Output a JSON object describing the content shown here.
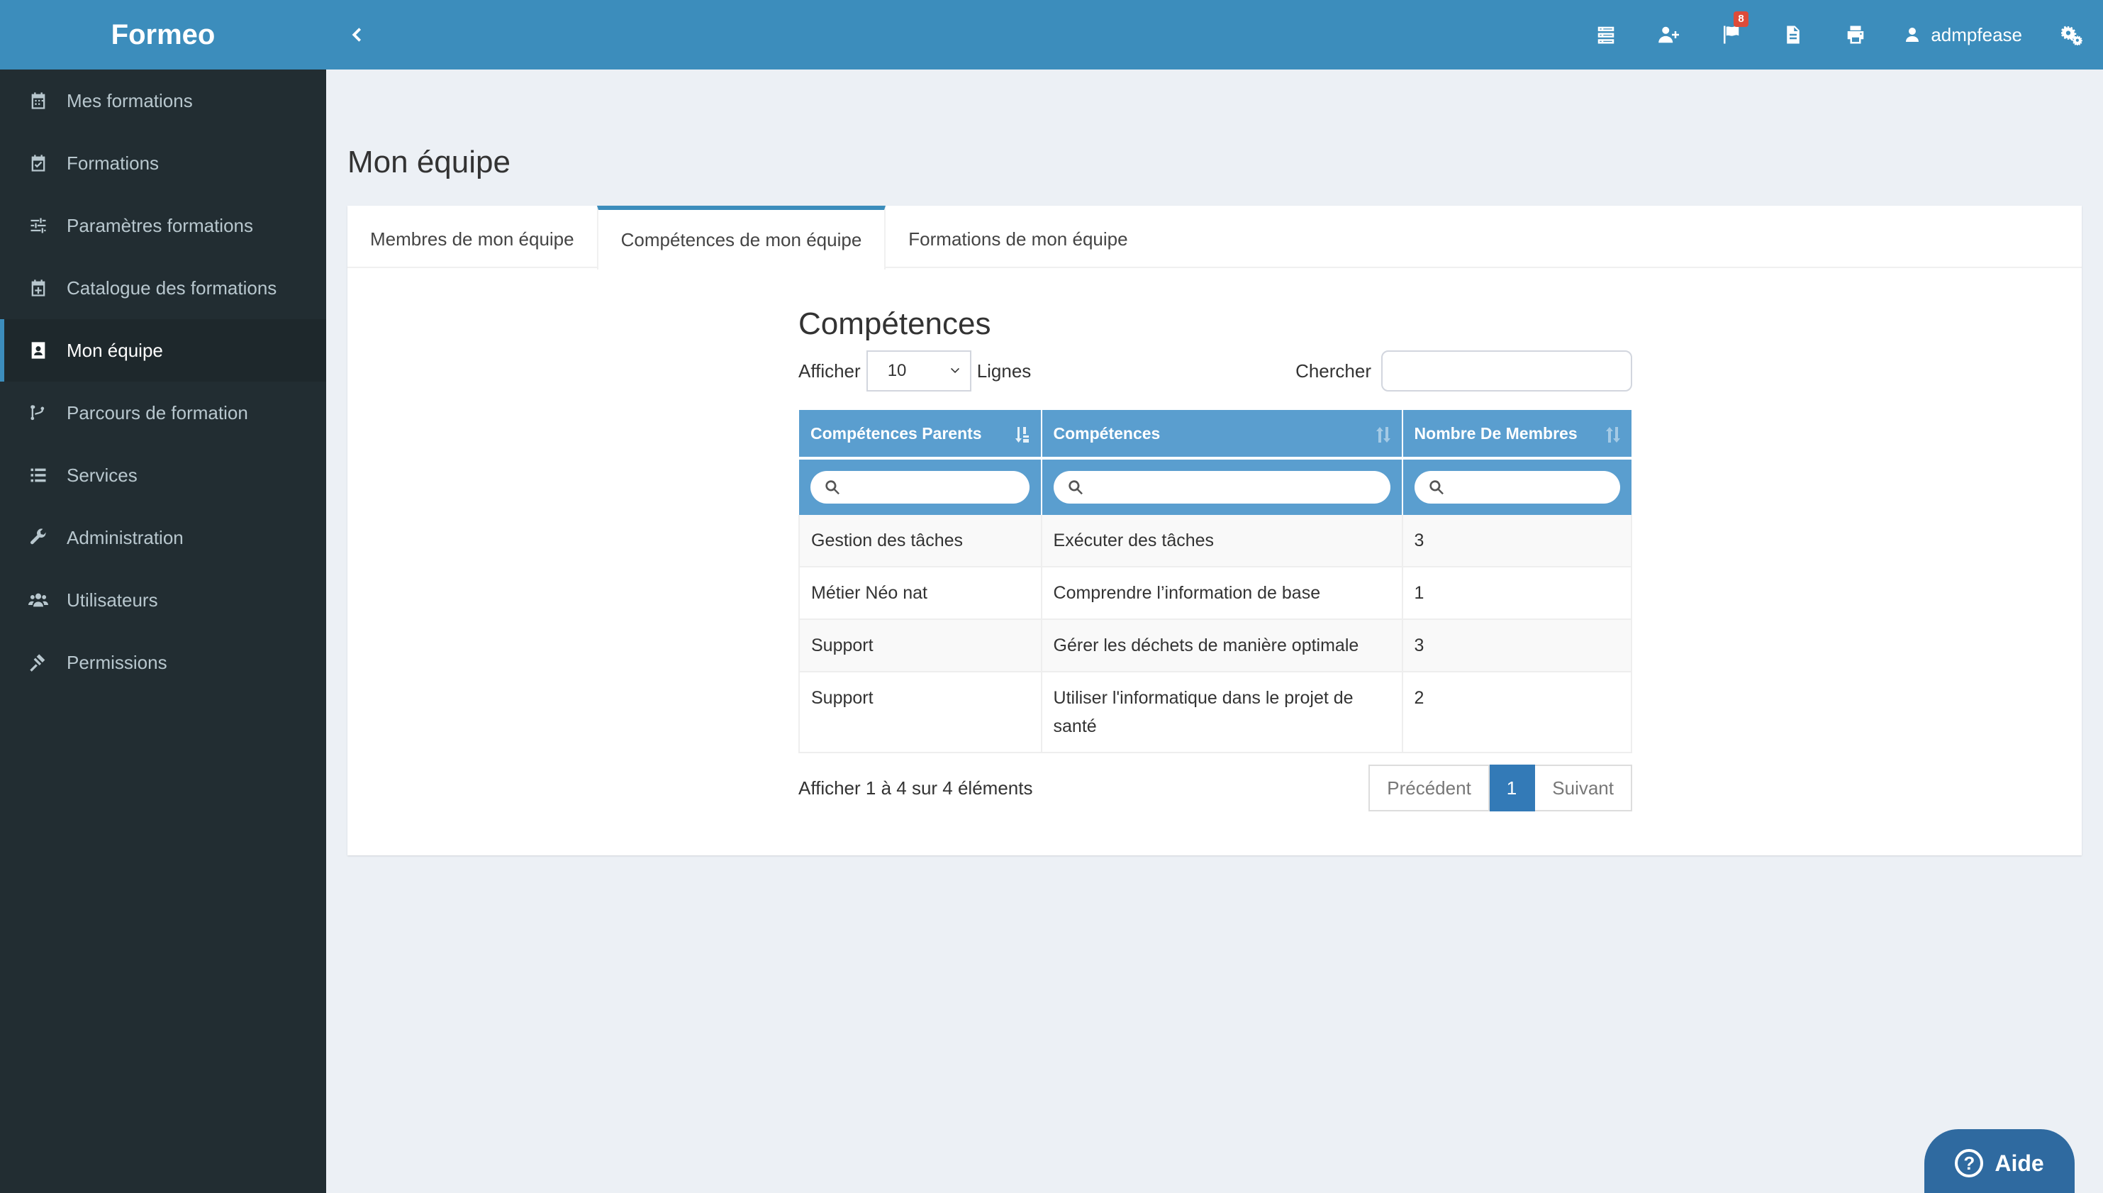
{
  "app": {
    "brand": "Formeo"
  },
  "sidebar": {
    "items": [
      {
        "label": "Mes formations",
        "icon": "calendar-icon"
      },
      {
        "label": "Formations",
        "icon": "calendar-check-icon"
      },
      {
        "label": "Paramètres formations",
        "icon": "sliders-icon"
      },
      {
        "label": "Catalogue des formations",
        "icon": "calendar-plus-icon"
      },
      {
        "label": "Mon équipe",
        "icon": "contact-card-icon",
        "active": true
      },
      {
        "label": "Parcours de formation",
        "icon": "branch-icon"
      },
      {
        "label": "Services",
        "icon": "list-icon"
      },
      {
        "label": "Administration",
        "icon": "wrench-icon"
      },
      {
        "label": "Utilisateurs",
        "icon": "users-icon"
      },
      {
        "label": "Permissions",
        "icon": "gavel-icon"
      }
    ]
  },
  "topbar": {
    "notification_count": "8",
    "username": "admpfease"
  },
  "page": {
    "title": "Mon équipe"
  },
  "tabs": [
    {
      "label": "Membres de mon équipe"
    },
    {
      "label": "Compétences de mon équipe",
      "active": true
    },
    {
      "label": "Formations de mon équipe"
    }
  ],
  "competences": {
    "title": "Compétences",
    "show_label": "Afficher",
    "page_size": "10",
    "rows_label": "Lignes",
    "search_label": "Chercher",
    "search_value": "",
    "columns": [
      "Compétences Parents",
      "Compétences",
      "Nombre De Membres"
    ],
    "rows": [
      [
        "Gestion des tâches",
        "Exécuter des tâches",
        "3"
      ],
      [
        "Métier Néo nat",
        "Comprendre l’information de base",
        "1"
      ],
      [
        "Support",
        "Gérer les déchets de manière optimale",
        "3"
      ],
      [
        "Support",
        "Utiliser l'informatique dans le projet de santé",
        "2"
      ]
    ],
    "info": "Afficher 1 à 4 sur 4 éléments",
    "pagination": {
      "prev": "Précédent",
      "current": "1",
      "next": "Suivant"
    }
  },
  "help": {
    "label": "Aide",
    "glyph": "?"
  }
}
